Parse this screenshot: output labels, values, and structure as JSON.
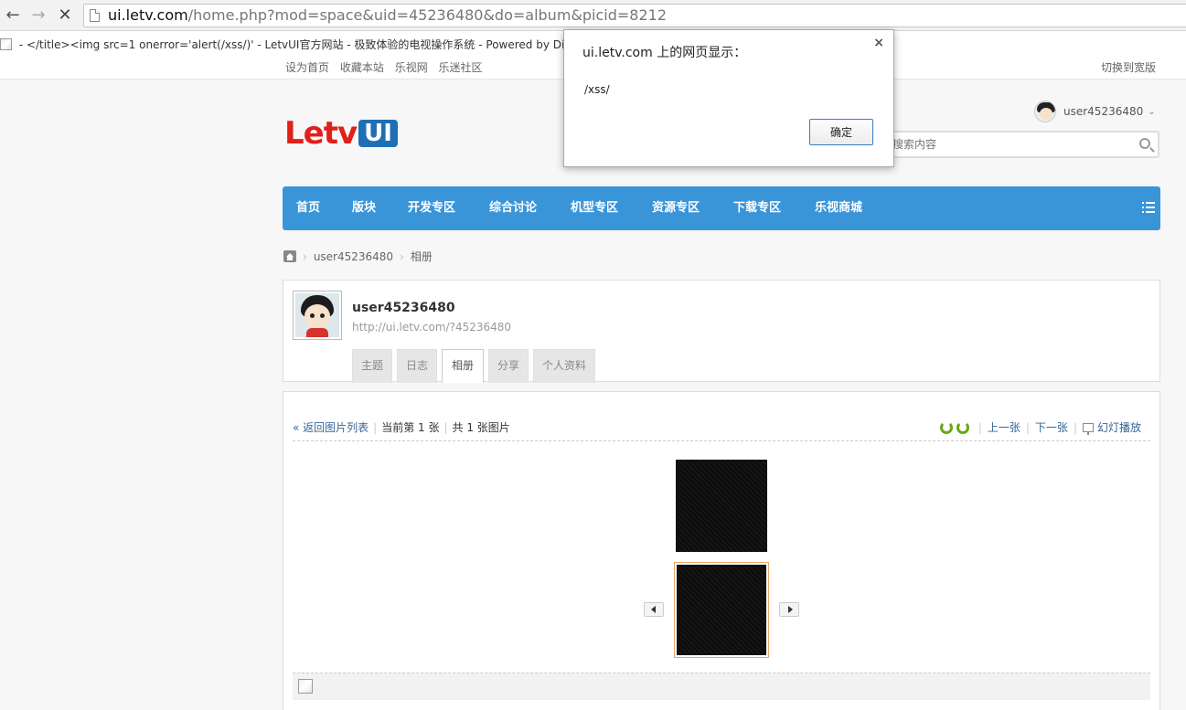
{
  "browser": {
    "url_host": "ui.letv.com",
    "url_rest": "/home.php?mod=space&uid=45236480&do=album&picid=8212",
    "back_icon": "←",
    "forward_icon": "→",
    "stop_icon": "✕"
  },
  "page_title_line": " - </title><img src=1 onerror='alert(/xss/)' - LetvUI官方网站 - 极致体验的电视操作系统 - Powered by Discu",
  "top_links": [
    "设为首页",
    "收藏本站",
    "乐视网",
    "乐迷社区"
  ],
  "widescreen": "切换到宽版",
  "logo": {
    "letv": "Letv",
    "ui": "UI"
  },
  "user": {
    "name": "user45236480",
    "caret": "⌄"
  },
  "search": {
    "placeholder": "搜索内容"
  },
  "nav": [
    "首页",
    "版块",
    "开发专区",
    "综合讨论",
    "机型专区",
    "资源专区",
    "下载专区",
    "乐视商城"
  ],
  "breadcrumb": {
    "user": "user45236480",
    "section": "相册",
    "sep": "›"
  },
  "profile": {
    "name": "user45236480",
    "url": "http://ui.letv.com/?45236480",
    "tabs": [
      "主题",
      "日志",
      "相册",
      "分享",
      "个人资料"
    ],
    "active_tab": "相册"
  },
  "album": {
    "back_link": "« 返回图片列表",
    "current": "当前第 1 张",
    "total": "共 1 张图片",
    "prev": "上一张",
    "next": "下一张",
    "slideshow": "幻灯播放"
  },
  "dialog": {
    "title": "ui.letv.com 上的网页显示：",
    "message": "/xss/",
    "ok": "确定",
    "close": "×"
  },
  "colors": {
    "nav_bg": "#3a95d8",
    "logo_red": "#e0201a",
    "logo_blue": "#1f6fb5",
    "link": "#336699"
  }
}
